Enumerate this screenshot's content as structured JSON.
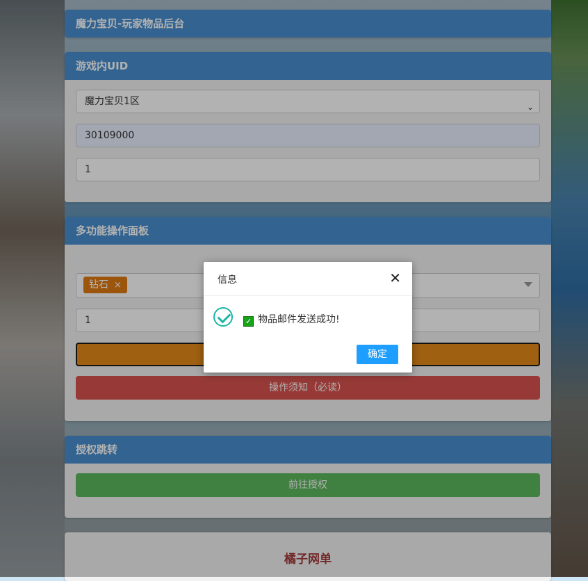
{
  "header": {
    "title": "魔力宝贝-玩家物品后台"
  },
  "uid_panel": {
    "title": "游戏内UID",
    "server_select": "魔力宝贝1区",
    "uid_value": "30109000",
    "quantity_value": "1"
  },
  "ops_panel": {
    "title": "多功能操作面板",
    "selected_tag": "钻石",
    "tag_remove": "×",
    "quantity_value": "1",
    "notice_button": "操作须知（必读）"
  },
  "auth_panel": {
    "title": "授权跳转",
    "go_button": "前往授权"
  },
  "footer_panel": {
    "title": "橘子网单"
  },
  "modal": {
    "title": "信息",
    "close": "✕",
    "message": "物品邮件发送成功!",
    "confirm": "确定"
  },
  "colors": {
    "panel_header": "#4a8fcf",
    "orange": "#e48a1a",
    "red": "#d9534f",
    "green": "#5cb85c",
    "confirm_blue": "#1e9fff",
    "success_teal": "#1fb5a5"
  },
  "icons": {
    "select_caret": "chevron-down-icon",
    "success": "check-circle-icon",
    "checkbox": "checkbox-checked-icon",
    "close": "close-icon"
  }
}
